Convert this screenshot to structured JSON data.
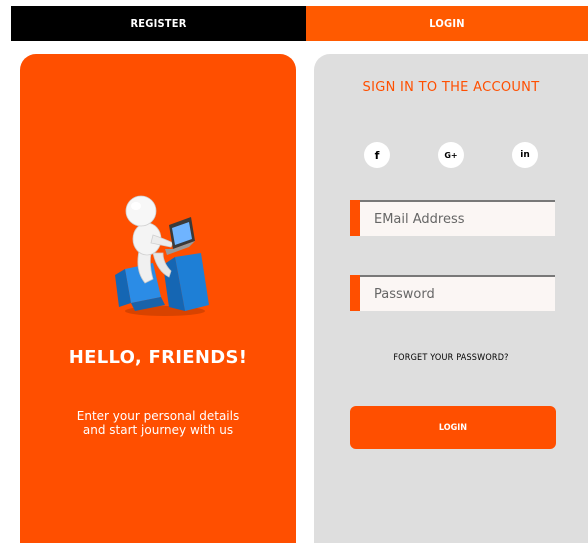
{
  "tabs": {
    "register": "REGISTER",
    "login": "LOGIN"
  },
  "left": {
    "heading": "HELLO, FRIENDS!",
    "line1": "Enter your personal details",
    "line2": "and start journey with us"
  },
  "right": {
    "title": "SIGN IN TO THE ACCOUNT",
    "social": {
      "facebook": "f",
      "google": "G+",
      "linkedin": "in"
    },
    "email_placeholder": "EMail Address",
    "password_placeholder": "Password",
    "forgot": "FORGET YOUR PASSWORD?",
    "login_button": "LOGIN"
  },
  "colors": {
    "accent": "#ff4f00",
    "tab_dark": "#000000",
    "panel_gray": "#dedede"
  }
}
